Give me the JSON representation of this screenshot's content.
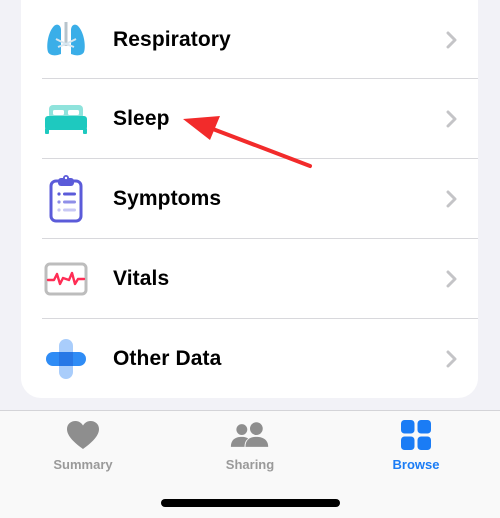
{
  "browse_list": {
    "items": [
      {
        "label": "Respiratory",
        "icon": "lungs-icon"
      },
      {
        "label": "Sleep",
        "icon": "bed-icon"
      },
      {
        "label": "Symptoms",
        "icon": "clipboard-icon"
      },
      {
        "label": "Vitals",
        "icon": "heart-monitor-icon"
      },
      {
        "label": "Other Data",
        "icon": "plus-cross-icon"
      }
    ]
  },
  "tab_bar": {
    "tabs": [
      {
        "label": "Summary",
        "icon": "heart-icon",
        "active": false
      },
      {
        "label": "Sharing",
        "icon": "people-icon",
        "active": false
      },
      {
        "label": "Browse",
        "icon": "grid-icon",
        "active": true
      }
    ]
  },
  "colors": {
    "accent": "#1a7cf5",
    "annotation_arrow": "#f22b2b",
    "respiratory": "#3aaee8",
    "sleep": "#1ec9bf",
    "symptoms": "#5b5bd9",
    "vitals": "#ff2d55",
    "other_data": "#2f8cf5"
  },
  "annotation": {
    "type": "arrow",
    "target": "Sleep"
  }
}
